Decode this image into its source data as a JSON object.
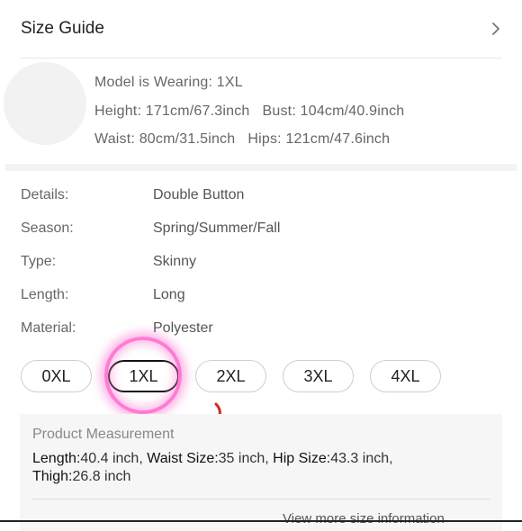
{
  "size_guide": {
    "title": "Size Guide"
  },
  "model": {
    "wearing": "Model is Wearing: 1XL",
    "height": "Height: 171cm/67.3inch",
    "bust": "Bust: 104cm/40.9inch",
    "waist": "Waist: 80cm/31.5inch",
    "hips": "Hips: 121cm/47.6inch"
  },
  "details": [
    {
      "label": "Details:",
      "value": "Double Button"
    },
    {
      "label": "Season:",
      "value": "Spring/Summer/Fall"
    },
    {
      "label": "Type:",
      "value": "Skinny"
    },
    {
      "label": "Length:",
      "value": "Long"
    },
    {
      "label": "Material:",
      "value": "Polyester"
    }
  ],
  "sizes": {
    "options": [
      "0XL",
      "1XL",
      "2XL",
      "3XL",
      "4XL"
    ],
    "selected": "1XL"
  },
  "measurement": {
    "title": "Product Measurement",
    "length_label": "Length:",
    "length_value": "40.4 inch,",
    "waist_label": "Waist Size:",
    "waist_value": "35 inch,",
    "hip_label": "Hip Size:",
    "hip_value": "43.3 inch,",
    "thigh_label": "Thigh:",
    "thigh_value": "26.8 inch",
    "more_link": "View more size information"
  },
  "colors": {
    "highlight": "#ff7bd3",
    "arrow": "#d32a1f"
  },
  "icons": {
    "size_guide_chevron": "chevron-right-icon"
  }
}
